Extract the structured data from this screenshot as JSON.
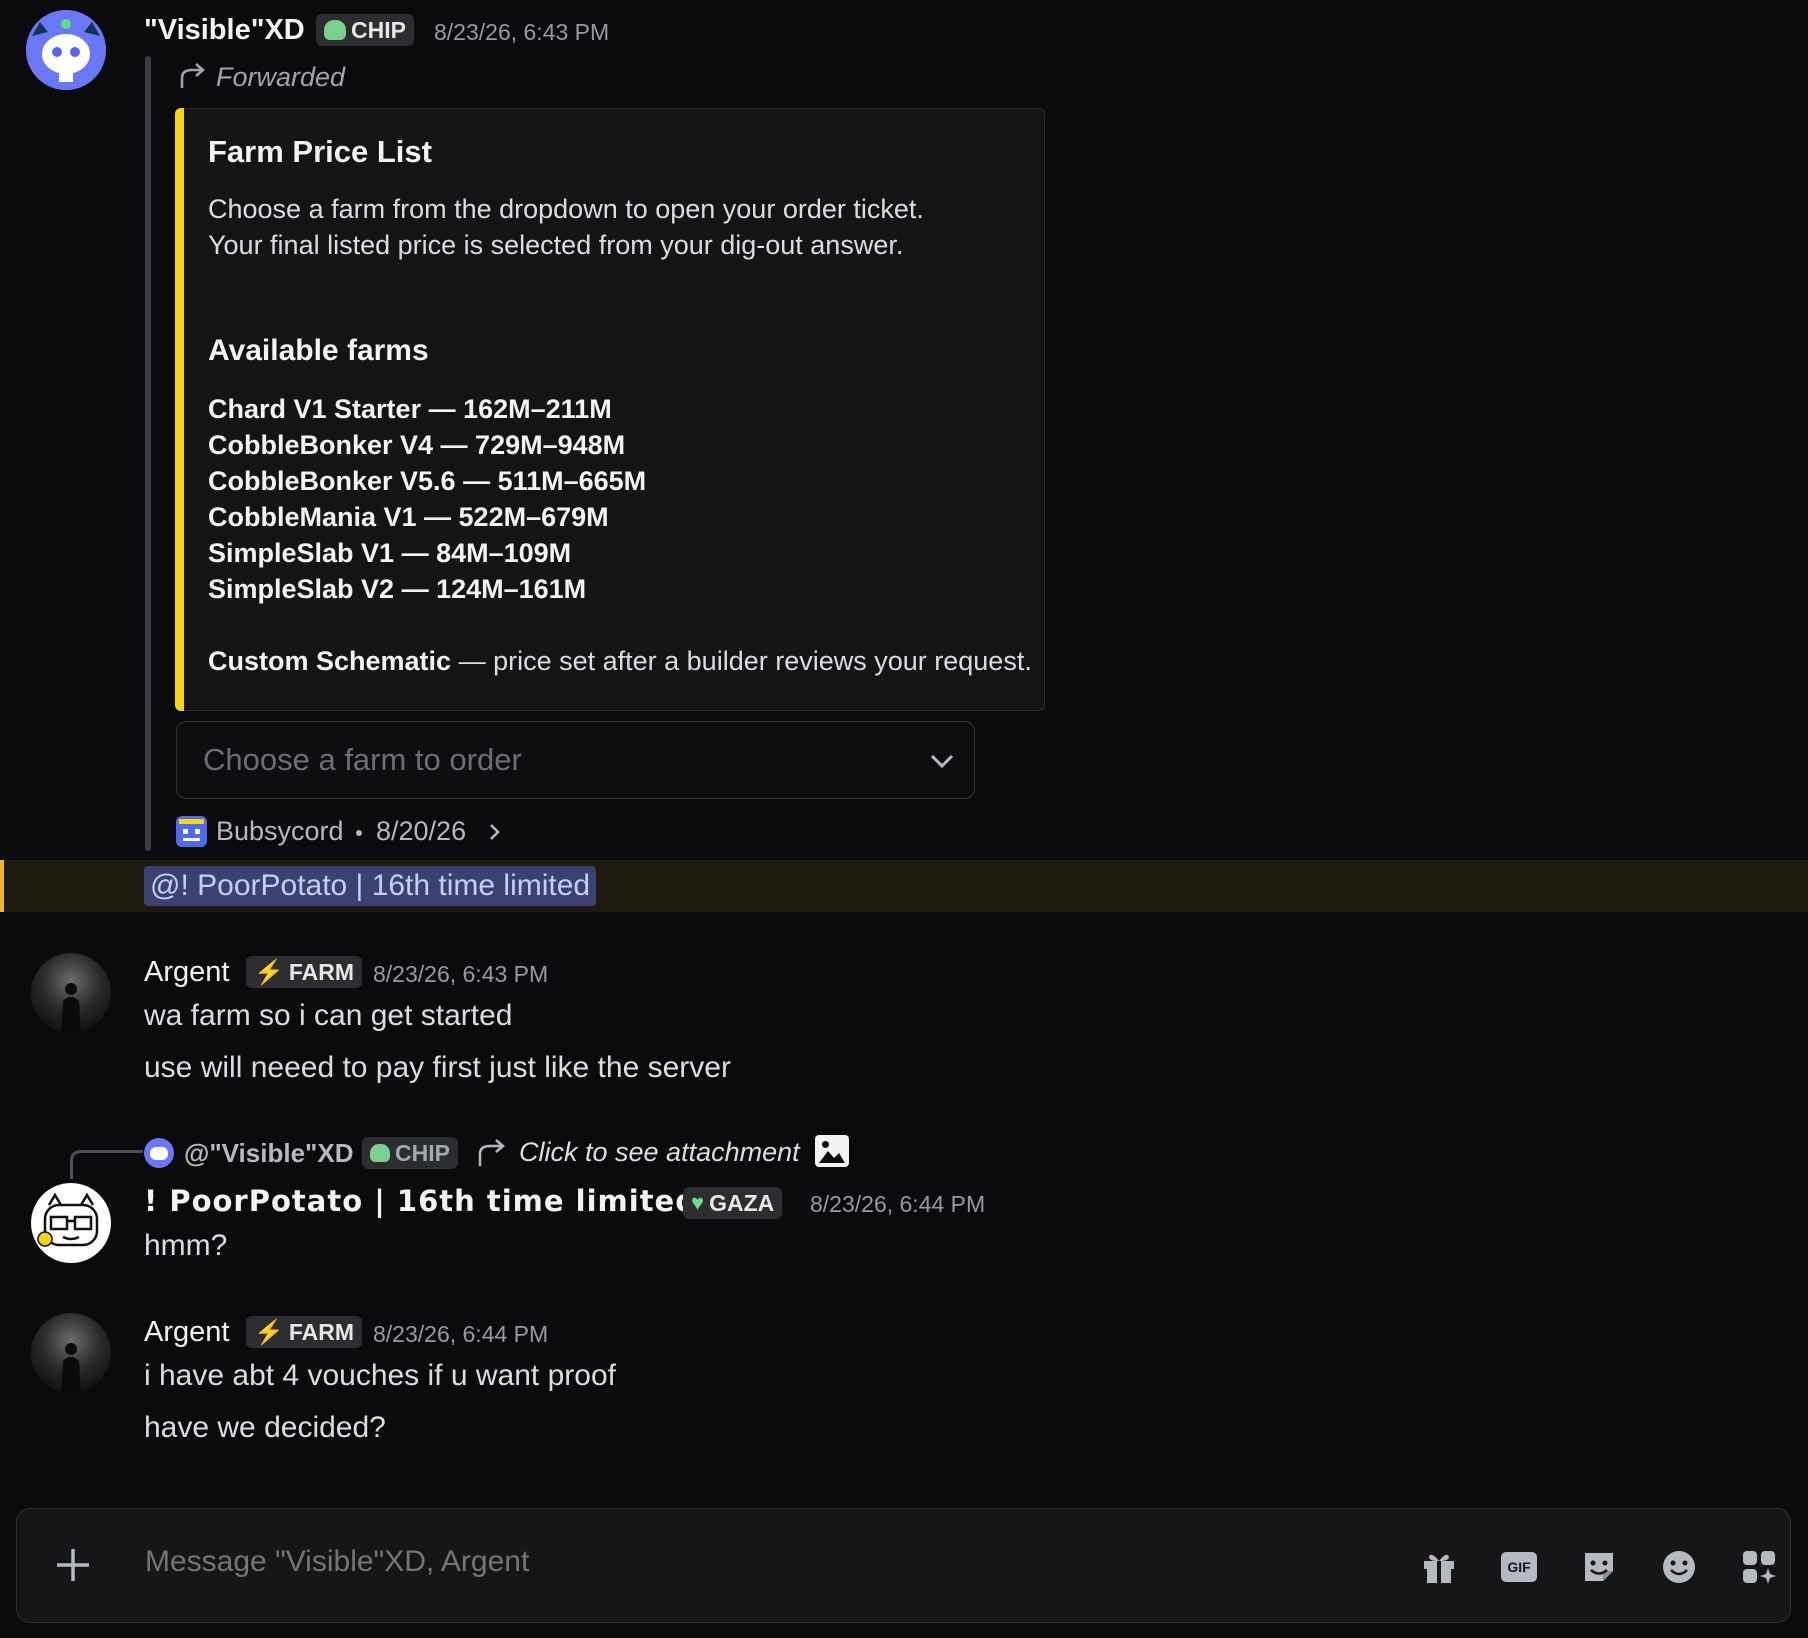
{
  "messages": {
    "first": {
      "author": "\"Visible\"XD",
      "tag": "CHIP",
      "timestamp": "8/23/26, 6:43 PM",
      "forwarded_label": "Forwarded",
      "embed": {
        "title": "Farm Price List",
        "line1": "Choose a farm from the dropdown to open your order ticket.",
        "line2": "Your final listed price is selected from your dig-out answer.",
        "heading": "Available farms",
        "farms": [
          "Chard V1 Starter — 162M–211M",
          "CobbleBonker V4 — 729M–948M",
          "CobbleBonker V5.6 — 511M–665M",
          "CobbleMania V1 — 522M–679M",
          "SimpleSlab V1 — 84M–109M",
          "SimpleSlab V2 — 124M–161M"
        ],
        "custom_bold": "Custom Schematic",
        "custom_rest": " — price set after a builder reviews your request.",
        "accent": "#f7d613"
      },
      "select_placeholder": "Choose a farm to order",
      "source_name": "Bubsycord",
      "source_date": "8/20/26",
      "mention": "@! PoorPotato | 16th time limited"
    },
    "second": {
      "author": "Argent",
      "tag": "FARM",
      "timestamp": "8/23/26, 6:43 PM",
      "lines": [
        "wa farm so i can get started",
        "use will neeed to pay first just like the server"
      ]
    },
    "third": {
      "reply_author": "@\"Visible\"XD",
      "reply_tag": "CHIP",
      "reply_text": "Click to see attachment",
      "author": "! PoorPotato | 16th time limited",
      "tag": "GAZA",
      "timestamp": "8/23/26, 6:44 PM",
      "lines": [
        "hmm?"
      ]
    },
    "fourth": {
      "author": "Argent",
      "tag": "FARM",
      "timestamp": "8/23/26, 6:44 PM",
      "lines": [
        "i have abt 4 vouches if u want proof",
        "have we decided?"
      ]
    }
  },
  "composer": {
    "placeholder": "Message \"Visible\"XD, Argent",
    "icons": [
      "plus-icon",
      "gift-icon",
      "gif-icon",
      "sticker-icon",
      "emoji-icon",
      "apps-icon"
    ],
    "gif_label": "GIF"
  },
  "colors": {
    "background": "#0b0b0d",
    "mention_bg": "#3c4270",
    "highlight": "#f0b232"
  }
}
